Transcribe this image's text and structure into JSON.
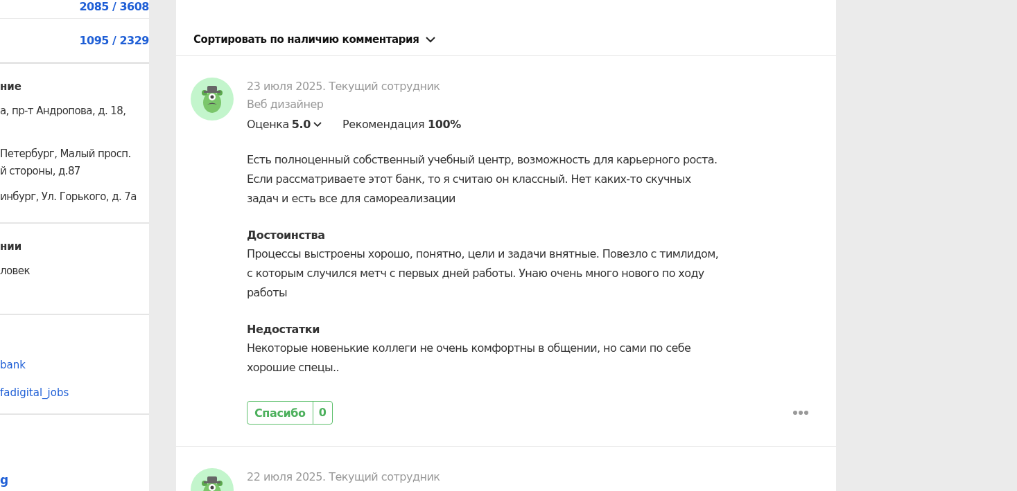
{
  "sidebar": {
    "counters": [
      {
        "value": "2085 / 3608"
      },
      {
        "value": "1095 / 2329"
      }
    ],
    "sections": [
      {
        "title": "ние",
        "lines": [
          [
            "а, пр-т Андропова, д. 18,"
          ],
          [
            "Петербург, Малый просп.",
            "й стороны, д.87"
          ],
          [
            "инбург, Ул. Горького, д. 7а"
          ]
        ]
      },
      {
        "title": "нии",
        "lines": [
          [
            "ловек"
          ]
        ]
      }
    ],
    "links": [
      "bank",
      "fadigital_jobs"
    ],
    "bottom_link": "g"
  },
  "sort": {
    "label": "Сортировать по наличию комментария"
  },
  "reviews": [
    {
      "date": "23 июля 2025. Текущий сотрудник",
      "position": "Веб дизайнер",
      "rating_label": "Оценка",
      "rating": "5.0",
      "recommend_label": "Рекомендация",
      "recommend": "100%",
      "text": "Есть полноценный собственный учебный центр, возможность для карьерного роста. Если рассматриваете этот банк, то я считаю он классный. Нет каких-то скучных задач и есть все для самореализации",
      "pros_title": "Достоинства",
      "pros": "Процессы выстроены хорошо, понятно, цели и задачи внятные. Повезло с тимлидом, с которым случился метч с первых дней работы. Унаю очень много нового по ходу работы",
      "cons_title": "Недостатки",
      "cons": "Некоторые новенькие коллеги не очень комфортны в общении, но сами по себе хорошие спецы..",
      "thanks_label": "Спасибо",
      "thanks_count": "0"
    },
    {
      "date": "22 июля 2025. Текущий сотрудник"
    }
  ]
}
